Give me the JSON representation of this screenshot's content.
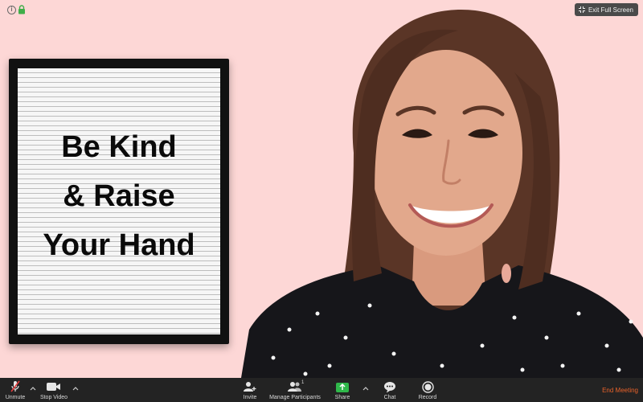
{
  "header": {
    "exit_fullscreen_label": "Exit Full Screen"
  },
  "letter_board": {
    "lines": [
      "Be Kind",
      "& Raise",
      "Your Hand"
    ]
  },
  "toolbar": {
    "unmute_label": "Unmute",
    "stop_video_label": "Stop Video",
    "invite_label": "Invite",
    "manage_participants_label": "Manage Participants",
    "participant_count": "1",
    "share_label": "Share",
    "chat_label": "Chat",
    "record_label": "Record",
    "end_meeting_label": "End Meeting"
  },
  "colors": {
    "background": "#fdd7d6",
    "toolbar": "#232323",
    "share_green": "#2fb84a",
    "end_meeting": "#e8622a"
  },
  "icons": [
    "info-icon",
    "lock-icon",
    "exit-fullscreen-icon",
    "microphone-muted-icon",
    "video-camera-icon",
    "add-person-icon",
    "participants-icon",
    "share-screen-icon",
    "chat-bubble-icon",
    "record-icon",
    "chevron-up-icon"
  ]
}
